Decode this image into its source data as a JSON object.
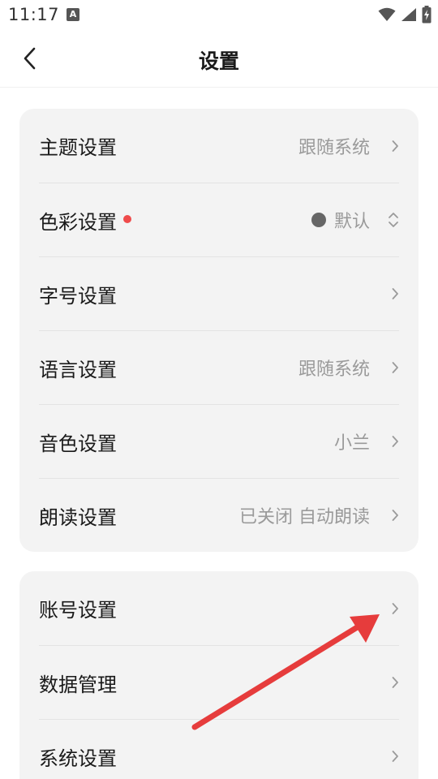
{
  "status": {
    "time": "11:17",
    "notification_letter": "A"
  },
  "header": {
    "title": "设置"
  },
  "groups": [
    {
      "items": [
        {
          "label": "主题设置",
          "value": "跟随系统"
        },
        {
          "label": "色彩设置",
          "value": "默认",
          "color_dot": "#666666",
          "badge_color": "#ef4b4b"
        },
        {
          "label": "字号设置",
          "value": ""
        },
        {
          "label": "语言设置",
          "value": "跟随系统"
        },
        {
          "label": "音色设置",
          "value": "小兰"
        },
        {
          "label": "朗读设置",
          "value": "已关闭 自动朗读"
        }
      ]
    },
    {
      "items": [
        {
          "label": "账号设置",
          "value": ""
        },
        {
          "label": "数据管理",
          "value": ""
        },
        {
          "label": "系统设置",
          "value": ""
        }
      ]
    }
  ],
  "annotation": {
    "type": "arrow",
    "color": "#e63c3c",
    "target": "账号设置"
  }
}
